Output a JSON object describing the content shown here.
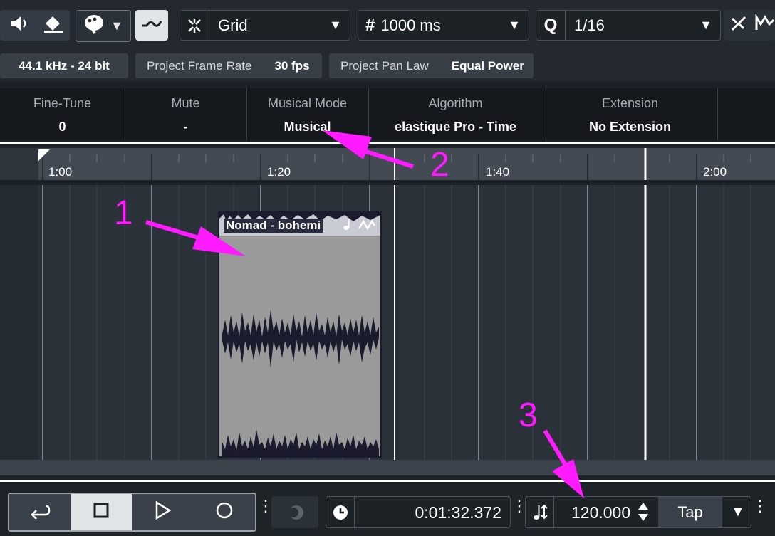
{
  "toolbar": {
    "snap_type": "Grid",
    "grid_value": "1000 ms",
    "quantize": "1/16"
  },
  "info": {
    "sample_rate": "44.1 kHz - 24 bit",
    "frame_rate_label": "Project Frame Rate",
    "frame_rate_value": "30 fps",
    "pan_law_label": "Project Pan Law",
    "pan_law_value": "Equal Power"
  },
  "inspector": {
    "fine_tune_label": "Fine-Tune",
    "fine_tune_value": "0",
    "mute_label": "Mute",
    "mute_value": "-",
    "mode_label": "Musical Mode",
    "mode_value": "Musical",
    "algorithm_label": "Algorithm",
    "algorithm_value": "elastique Pro - Time",
    "extension_label": "Extension",
    "extension_value": "No Extension"
  },
  "ruler": {
    "labels": [
      "1:00",
      "1:20",
      "1:40",
      "2:00"
    ]
  },
  "event": {
    "name": "Nomad - bohemi"
  },
  "transport": {
    "time": "0:01:32.372",
    "tempo": "120.000",
    "tap_label": "Tap"
  },
  "annotations": [
    "1",
    "2",
    "3"
  ],
  "colors": {
    "annotation": "#ff1aff",
    "event_bg": "#9a9a9a",
    "waveform": "#1a1c2e"
  }
}
